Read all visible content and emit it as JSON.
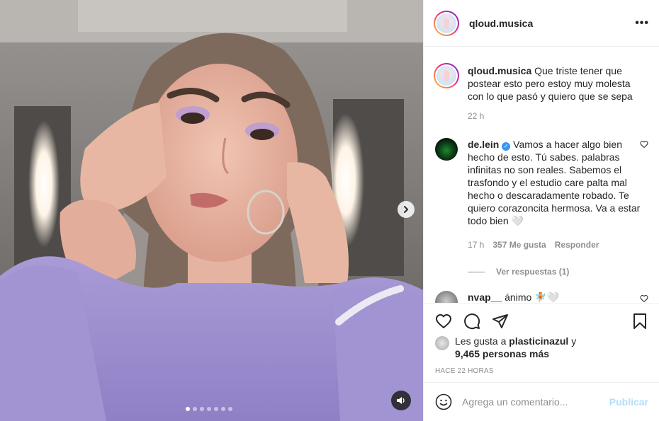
{
  "post": {
    "username": "qloud.musica",
    "more_icon": "more-horizontal-icon",
    "caption": {
      "username": "qloud.musica",
      "text": "Que triste tener que postear esto pero estoy muy molesta con lo que pasó y quiero que se sepa",
      "time": "22 h"
    },
    "comments": [
      {
        "username": "de.lein",
        "verified": true,
        "text": "Vamos a hacer algo bien hecho de esto. Tú sabes. palabras infinitas no son reales. Sabemos el trasfondo y el estudio care palta mal hecho o descaradamente robado. Te quiero corazoncita hermosa. Va a estar todo bien 🤍",
        "time": "17 h",
        "likes": "357 Me gusta",
        "reply": "Responder",
        "view_replies": "Ver respuestas (1)"
      },
      {
        "username": "nvap__",
        "text": "ánimo 🧚🏼🤍"
      }
    ],
    "likes": {
      "prefix": "Les gusta a",
      "user": "plasticinazul",
      "connector": "y",
      "count": "9,465 personas más"
    },
    "timestamp": "HACE 22 HORAS",
    "add_comment": {
      "placeholder": "Agrega un comentario...",
      "post_label": "Publicar"
    },
    "carousel": {
      "total": 7,
      "active": 0
    }
  }
}
